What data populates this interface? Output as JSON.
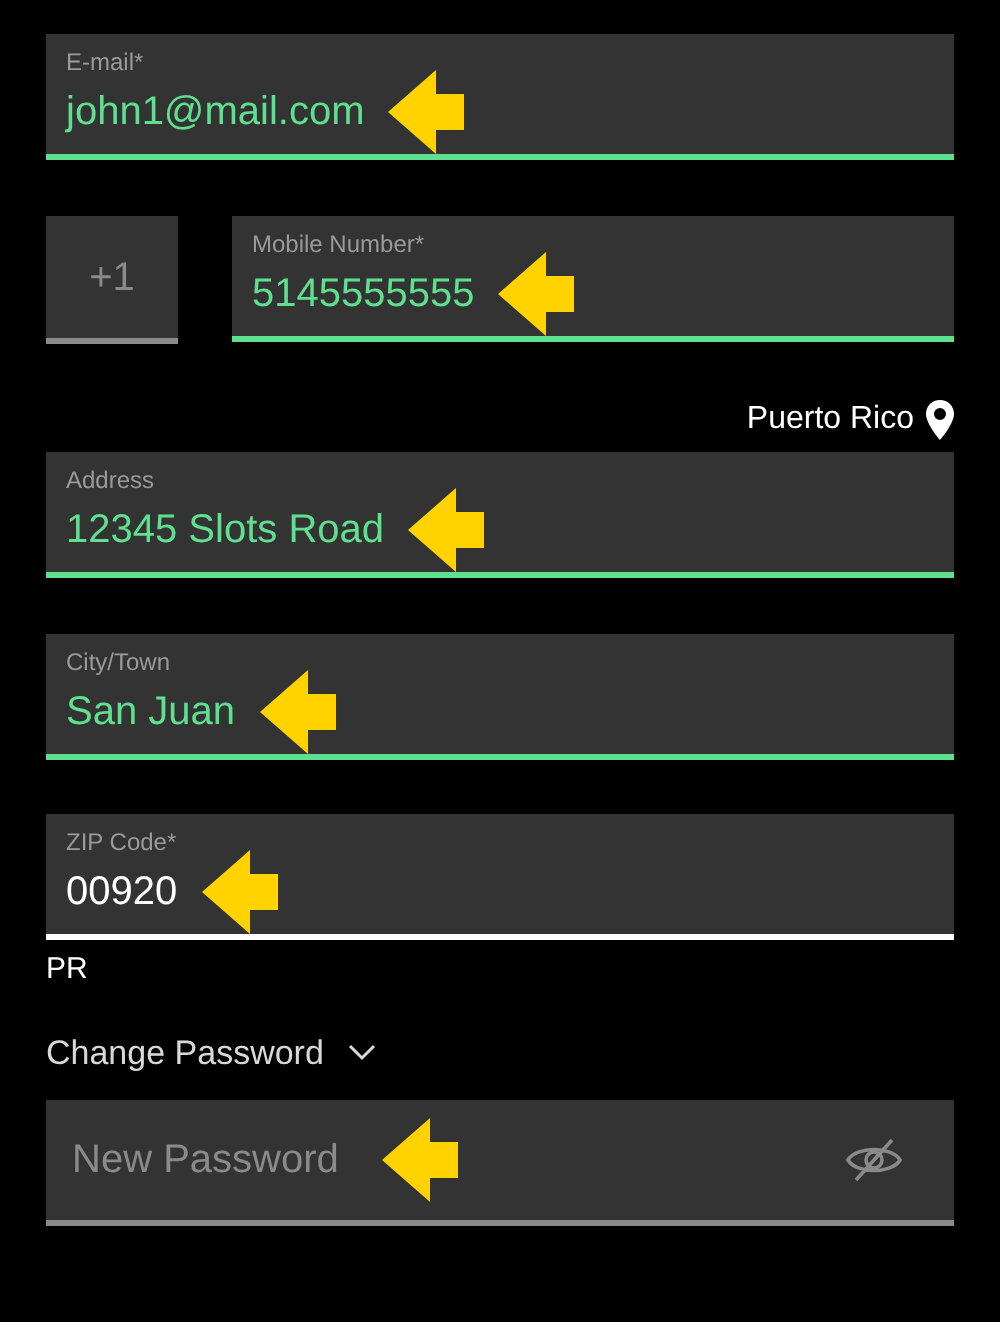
{
  "email": {
    "label": "E-mail*",
    "value": "john1@mail.com",
    "focused": false,
    "annotated": true
  },
  "country_code": {
    "value": "+1"
  },
  "mobile": {
    "label": "Mobile Number*",
    "value": "5145555555",
    "focused": false,
    "annotated": true
  },
  "location": {
    "text": "Puerto Rico"
  },
  "address": {
    "label": "Address",
    "value": "12345 Slots Road",
    "focused": false,
    "annotated": true
  },
  "city": {
    "label": "City/Town",
    "value": "San Juan",
    "focused": false,
    "annotated": true
  },
  "zip": {
    "label": "ZIP Code*",
    "value": "00920",
    "focused": true,
    "annotated": true
  },
  "state_code": "PR",
  "change_password": {
    "label": "Change Password",
    "expanded": true
  },
  "new_password": {
    "placeholder": "New Password",
    "annotated": true
  }
}
